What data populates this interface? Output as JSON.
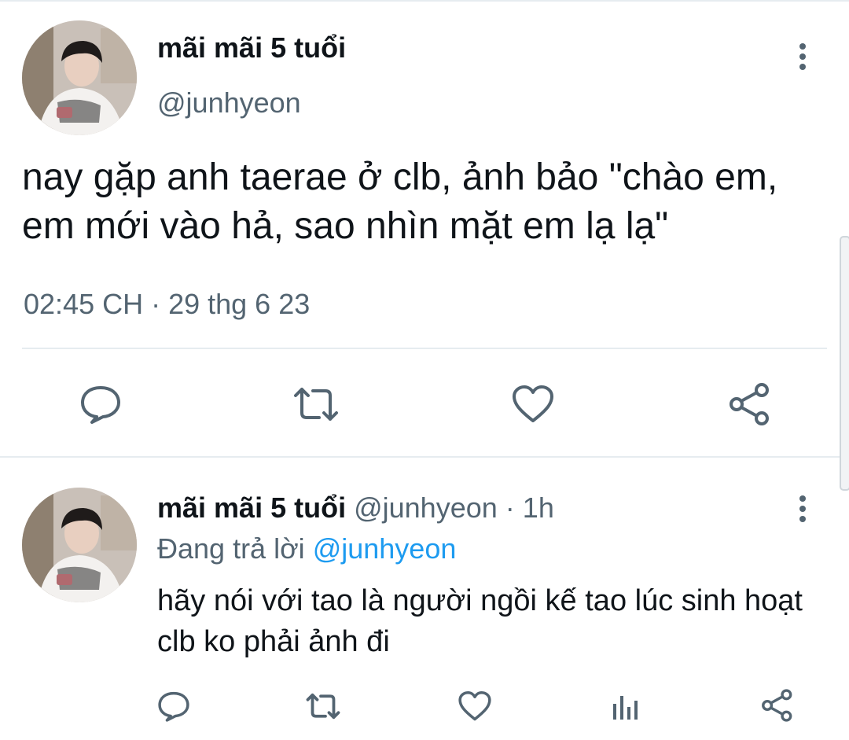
{
  "main_tweet": {
    "author_name": "mãi mãi 5 tuổi",
    "author_handle": "@junhyeon",
    "text": "nay gặp anh taerae ở clb, ảnh bảo \"chào em, em mới vào hả, sao nhìn mặt em lạ lạ\"",
    "timestamp": "02:45 CH · 29 thg 6 23",
    "actions": [
      "reply-icon",
      "retweet-icon",
      "like-icon",
      "share-icon"
    ]
  },
  "reply_tweet": {
    "author_name": "mãi mãi 5 tuổi",
    "author_handle": "@junhyeon",
    "separator": "·",
    "time_ago": "1h",
    "replying_label": "Đang trả lời",
    "replying_to": "@junhyeon",
    "text": "hãy nói với tao là người ngồi kế tao lúc sinh hoạt clb ko phải ảnh đi",
    "actions": [
      "reply-icon",
      "retweet-icon",
      "like-icon",
      "analytics-icon",
      "share-icon"
    ]
  },
  "colors": {
    "text": "#0f1419",
    "secondary": "#536471",
    "accent": "#1d9bf0",
    "divider": "#e6ecf0"
  }
}
